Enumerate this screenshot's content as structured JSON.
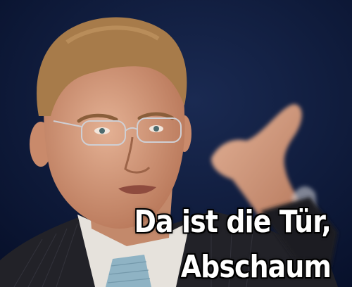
{
  "caption": {
    "line1": "Da ist die Tür,",
    "line2": "Abschaum"
  },
  "colors": {
    "background": "#0c1630",
    "caption_fill": "#ffffff",
    "caption_outline": "#000000",
    "suit": "#222228",
    "tie": "#8fb3c4",
    "shirt": "#e6e2dc",
    "skin": "#d9a484",
    "hair": "#a77b4a"
  }
}
